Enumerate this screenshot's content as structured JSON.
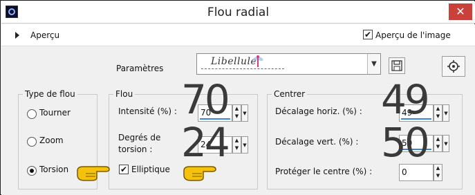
{
  "window": {
    "title": "Flou radial",
    "close_glyph": "✕",
    "app_icon": "app-icon"
  },
  "preview": {
    "label": "Aperçu",
    "preview_image_label": "Aperçu de l'image",
    "preview_image_checked": true
  },
  "params": {
    "label": "Paramètres",
    "preset_signature": "Libellule",
    "dragonfly_icon": "dragonfly-icon",
    "save_icon": "floppy-icon",
    "settings_icon": "settings-icon"
  },
  "type_group": {
    "title": "Type de flou",
    "options": [
      {
        "label": "Tourner",
        "selected": false
      },
      {
        "label": "Zoom",
        "selected": false
      },
      {
        "label": "Torsion",
        "selected": true
      }
    ]
  },
  "flou_group": {
    "title": "Flou",
    "intensity_label": "Intensité (%) :",
    "intensity_value": "70",
    "torsion_label_1": "Degrés de",
    "torsion_label_2": "torsion :",
    "torsion_value": "24",
    "elliptique_label": "Elliptique",
    "elliptique_checked": true
  },
  "centrer_group": {
    "title": "Centrer",
    "horiz_label": "Décalage horiz. (%) :",
    "horiz_value": "49",
    "vert_label": "Décalage vert. (%) :",
    "vert_value": "50",
    "protect_label": "Protéger le centre (%) :",
    "protect_value": "0"
  },
  "overlay": {
    "intensity_big": "70",
    "torsion_big": "24",
    "horiz_big": "49",
    "vert_big": "50",
    "pointer_icon": "pointing-hand-icon",
    "accent_color": "#f4c20d"
  }
}
